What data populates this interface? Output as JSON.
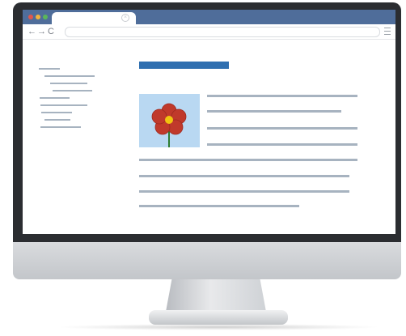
{
  "browser": {
    "tab_close_glyph": "×",
    "back_glyph": "←",
    "forward_glyph": "→",
    "reload_glyph": "C",
    "address": ""
  },
  "colors": {
    "tabbar": "#4f6d9a",
    "heading_bar": "#2f6fb0",
    "text_lines": "#a7b3c0",
    "image_bg": "#b9d8f2",
    "flower_petals": "#c0392b",
    "flower_center": "#f1c40f",
    "stem": "#2e7d32"
  },
  "icons": {
    "flower": "flower-icon",
    "menu": "hamburger-menu-icon"
  }
}
